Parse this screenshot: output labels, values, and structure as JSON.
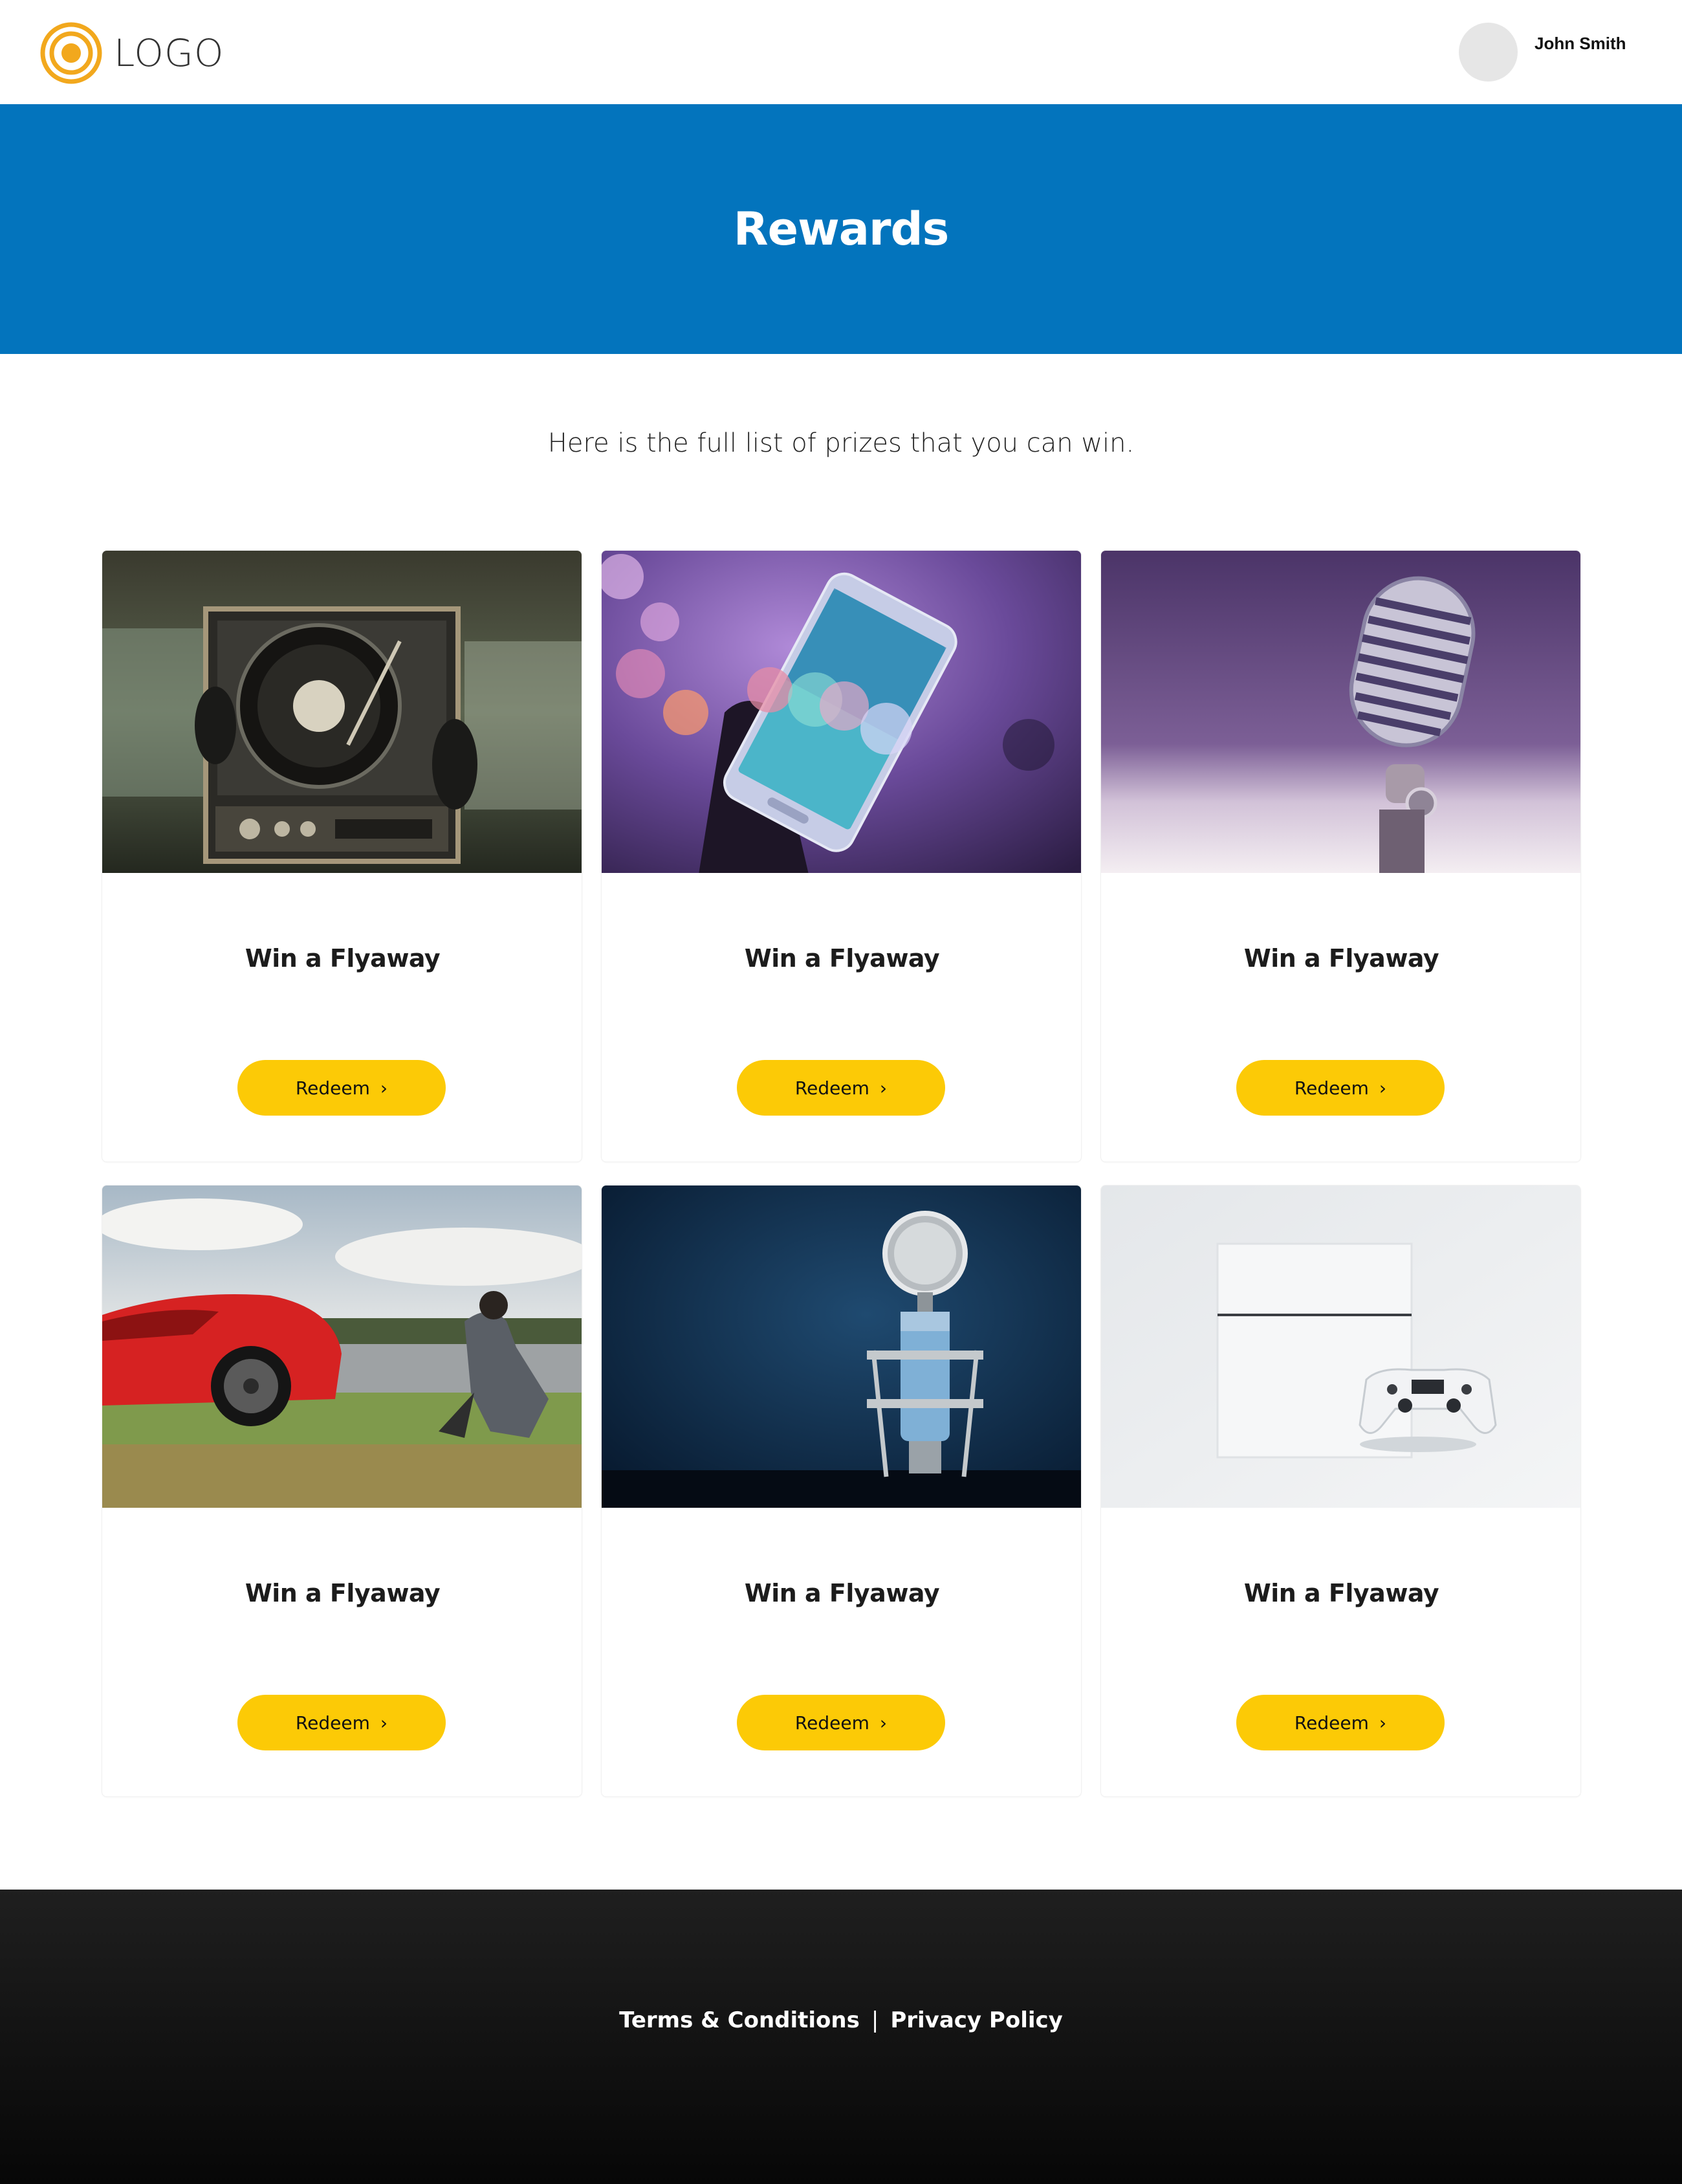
{
  "header": {
    "logo_text": "LOGO",
    "user_name": "John Smith"
  },
  "hero": {
    "title": "Rewards"
  },
  "intro": "Here is the full list of prizes that you can win.",
  "cards": [
    {
      "title": "Win a Flyaway",
      "button": "Redeem",
      "image": "turntable-photo"
    },
    {
      "title": "Win a Flyaway",
      "button": "Redeem",
      "image": "smartphone-photo"
    },
    {
      "title": "Win a Flyaway",
      "button": "Redeem",
      "image": "microphone-photo"
    },
    {
      "title": "Win a Flyaway",
      "button": "Redeem",
      "image": "sports-car-photo"
    },
    {
      "title": "Win a Flyaway",
      "button": "Redeem",
      "image": "blue-microphone-photo"
    },
    {
      "title": "Win a Flyaway",
      "button": "Redeem",
      "image": "game-console-photo"
    }
  ],
  "footer": {
    "terms": "Terms & Conditions",
    "separator": "|",
    "privacy": "Privacy Policy"
  },
  "colors": {
    "brand_blue": "#0374bd",
    "accent_yellow": "#fcca06",
    "logo_orange": "#f2a81d"
  }
}
